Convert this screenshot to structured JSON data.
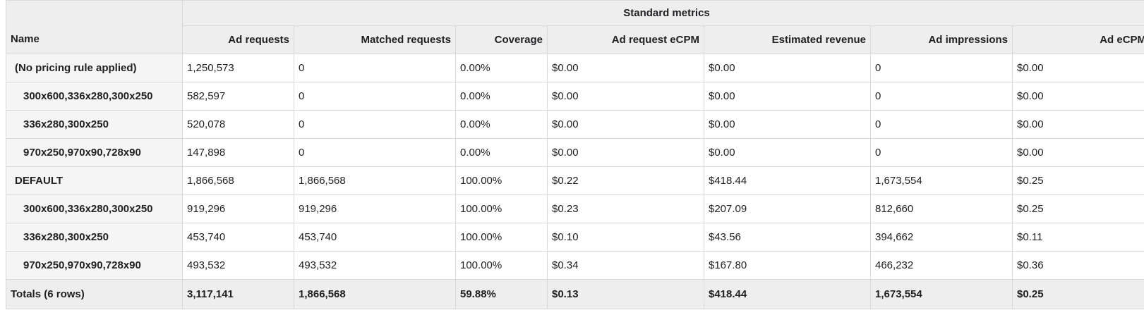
{
  "group_header": "Standard metrics",
  "columns": {
    "name": "Name",
    "ad_requests": "Ad requests",
    "matched_requests": "Matched requests",
    "coverage": "Coverage",
    "ad_request_ecpm": "Ad request eCPM",
    "estimated_revenue": "Estimated revenue",
    "ad_impressions": "Ad impressions",
    "ad_ecpm": "Ad eCPM"
  },
  "rows": [
    {
      "name": "(No pricing rule applied)",
      "level": 1,
      "ad_requests": "1,250,573",
      "matched_requests": "0",
      "coverage": "0.00%",
      "ad_request_ecpm": "$0.00",
      "estimated_revenue": "$0.00",
      "ad_impressions": "0",
      "ad_ecpm": "$0.00"
    },
    {
      "name": "300x600,336x280,300x250",
      "level": 2,
      "ad_requests": "582,597",
      "matched_requests": "0",
      "coverage": "0.00%",
      "ad_request_ecpm": "$0.00",
      "estimated_revenue": "$0.00",
      "ad_impressions": "0",
      "ad_ecpm": "$0.00"
    },
    {
      "name": "336x280,300x250",
      "level": 2,
      "ad_requests": "520,078",
      "matched_requests": "0",
      "coverage": "0.00%",
      "ad_request_ecpm": "$0.00",
      "estimated_revenue": "$0.00",
      "ad_impressions": "0",
      "ad_ecpm": "$0.00"
    },
    {
      "name": "970x250,970x90,728x90",
      "level": 2,
      "ad_requests": "147,898",
      "matched_requests": "0",
      "coverage": "0.00%",
      "ad_request_ecpm": "$0.00",
      "estimated_revenue": "$0.00",
      "ad_impressions": "0",
      "ad_ecpm": "$0.00"
    },
    {
      "name": "DEFAULT",
      "level": 1,
      "ad_requests": "1,866,568",
      "matched_requests": "1,866,568",
      "coverage": "100.00%",
      "ad_request_ecpm": "$0.22",
      "estimated_revenue": "$418.44",
      "ad_impressions": "1,673,554",
      "ad_ecpm": "$0.25"
    },
    {
      "name": "300x600,336x280,300x250",
      "level": 2,
      "ad_requests": "919,296",
      "matched_requests": "919,296",
      "coverage": "100.00%",
      "ad_request_ecpm": "$0.23",
      "estimated_revenue": "$207.09",
      "ad_impressions": "812,660",
      "ad_ecpm": "$0.25"
    },
    {
      "name": "336x280,300x250",
      "level": 2,
      "ad_requests": "453,740",
      "matched_requests": "453,740",
      "coverage": "100.00%",
      "ad_request_ecpm": "$0.10",
      "estimated_revenue": "$43.56",
      "ad_impressions": "394,662",
      "ad_ecpm": "$0.11"
    },
    {
      "name": "970x250,970x90,728x90",
      "level": 2,
      "ad_requests": "493,532",
      "matched_requests": "493,532",
      "coverage": "100.00%",
      "ad_request_ecpm": "$0.34",
      "estimated_revenue": "$167.80",
      "ad_impressions": "466,232",
      "ad_ecpm": "$0.36"
    }
  ],
  "totals": {
    "name": "Totals (6 rows)",
    "ad_requests": "3,117,141",
    "matched_requests": "1,866,568",
    "coverage": "59.88%",
    "ad_request_ecpm": "$0.13",
    "estimated_revenue": "$418.44",
    "ad_impressions": "1,673,554",
    "ad_ecpm": "$0.25"
  },
  "colors": {
    "header_bg": "#eeeeee",
    "name_cell_bg": "#f5f5f5",
    "border": "#d9d9d9",
    "text": "#202124"
  }
}
